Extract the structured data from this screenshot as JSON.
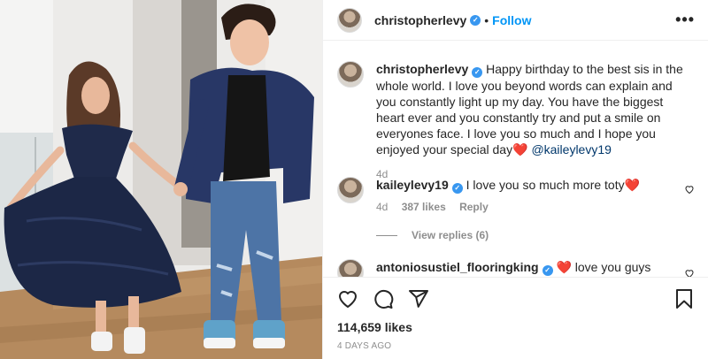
{
  "post": {
    "author": "christopherlevy",
    "verified": true,
    "follow_label": "Follow",
    "dot": "•",
    "more_label": "•••",
    "caption": {
      "username": "christopherlevy",
      "text": "Happy birthday to the best sis in the whole world. I love you beyond words can explain and you constantly light up my day. You have the biggest heart ever and you constantly try and put a smile on everyones face. I love you so much and I hope you enjoyed your special day",
      "emoji": "❤️",
      "mention": "@kaileylevy19",
      "time": "4d"
    },
    "comments": [
      {
        "username": "kaileylevy19",
        "verified": true,
        "text": "I love you so much more toty",
        "emoji": "❤️",
        "time": "4d",
        "likes": "387 likes",
        "reply_label": "Reply",
        "view_replies": "View replies (6)"
      },
      {
        "username": "antoniosustiel_flooringking",
        "verified": true,
        "emoji": "❤️",
        "text": "love you guys"
      }
    ],
    "likes_count": "114,659 likes",
    "posted_ago": "4 DAYS AGO"
  },
  "icons": {
    "like": "heart-icon",
    "comment": "comment-icon",
    "share": "share-icon",
    "save": "bookmark-icon",
    "more": "more-icon",
    "verified": "verified-badge-icon"
  },
  "colors": {
    "accent": "#0095f6",
    "verified": "#3897f0",
    "heart": "#ed1c24",
    "muted": "#8e8e8e"
  }
}
